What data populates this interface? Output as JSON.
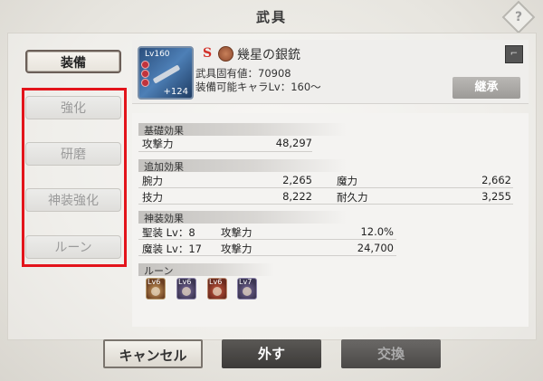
{
  "window": {
    "title": "武具"
  },
  "menu": {
    "equip": "装備",
    "strengthen": "強化",
    "polish": "研磨",
    "divine": "神装強化",
    "rune": "ルーン"
  },
  "weapon": {
    "level": "Lv160",
    "plus": "+124",
    "rarity": "S",
    "name": "幾星の銀銃",
    "unique_value": "武具固有値：70908",
    "equip_level": "装備可能キャラLv：160～",
    "inherit_label": "継承"
  },
  "basic": {
    "header": "基礎効果",
    "stats": [
      {
        "label": "攻撃力",
        "value": "48,297"
      }
    ]
  },
  "additional": {
    "header": "追加効果",
    "left": [
      {
        "label": "腕力",
        "value": "2,265"
      },
      {
        "label": "技力",
        "value": "8,222"
      }
    ],
    "right": [
      {
        "label": "魔力",
        "value": "2,662"
      },
      {
        "label": "耐久力",
        "value": "3,255"
      }
    ]
  },
  "divine": {
    "header": "神装効果",
    "rows": [
      {
        "level": "聖装 Lv：8",
        "label": "攻撃力",
        "value": "12.0%"
      },
      {
        "level": "魔装 Lv：17",
        "label": "攻撃力",
        "value": "24,700"
      }
    ]
  },
  "runes": {
    "header": "ルーン",
    "items": [
      "Lv6",
      "Lv6",
      "Lv6",
      "Lv7"
    ]
  },
  "buttons": {
    "cancel": "キャンセル",
    "remove": "外す",
    "exchange": "交換"
  },
  "help_icon": "question-diamond-icon",
  "colors": {
    "rarity": "#d2322b",
    "highlight_box": "#e3141b"
  }
}
